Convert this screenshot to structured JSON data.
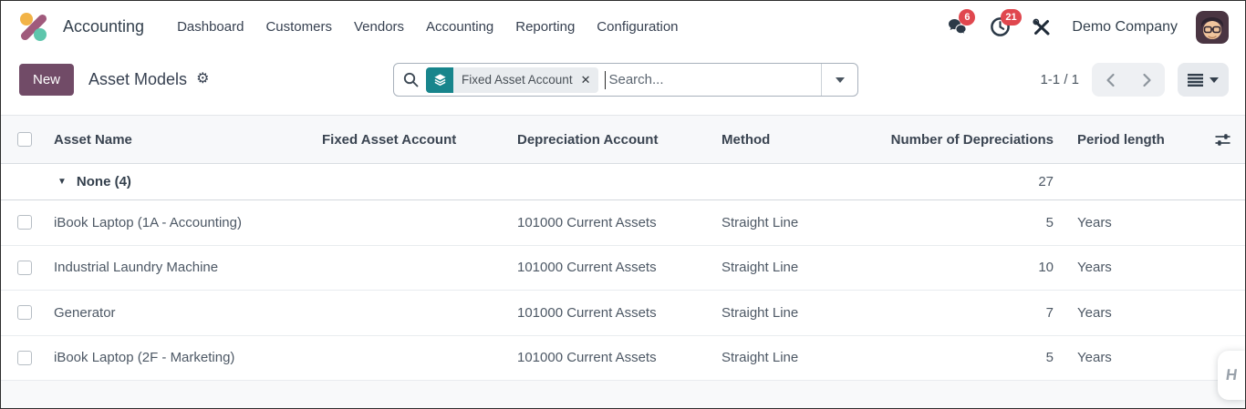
{
  "navbar": {
    "app_name": "Accounting",
    "menu_items": [
      {
        "label": "Dashboard"
      },
      {
        "label": "Customers"
      },
      {
        "label": "Vendors"
      },
      {
        "label": "Accounting"
      },
      {
        "label": "Reporting"
      },
      {
        "label": "Configuration"
      }
    ],
    "messages_badge": "6",
    "activities_badge": "21",
    "company_name": "Demo Company"
  },
  "control_panel": {
    "new_button_label": "New",
    "title": "Asset Models",
    "search": {
      "facet_label": "Fixed Asset Account",
      "placeholder": "Search..."
    },
    "pager_text": "1-1 / 1"
  },
  "table": {
    "headers": {
      "asset_name": "Asset Name",
      "fixed_asset_account": "Fixed Asset Account",
      "depreciation_account": "Depreciation Account",
      "method": "Method",
      "number_of_depreciations": "Number of Depreciations",
      "period_length": "Period length"
    },
    "group_row": {
      "label": "None (4)",
      "number_of_depreciations_sum": "27"
    },
    "rows": [
      {
        "asset_name": "iBook Laptop (1A - Accounting)",
        "fixed_asset_account": "",
        "depreciation_account": "101000 Current Assets",
        "method": "Straight Line",
        "number_of_depreciations": "5",
        "period_length": "Years"
      },
      {
        "asset_name": "Industrial Laundry Machine",
        "fixed_asset_account": "",
        "depreciation_account": "101000 Current Assets",
        "method": "Straight Line",
        "number_of_depreciations": "10",
        "period_length": "Years"
      },
      {
        "asset_name": "Generator",
        "fixed_asset_account": "",
        "depreciation_account": "101000 Current Assets",
        "method": "Straight Line",
        "number_of_depreciations": "7",
        "period_length": "Years"
      },
      {
        "asset_name": "iBook Laptop (2F - Marketing)",
        "fixed_asset_account": "",
        "depreciation_account": "101000 Current Assets",
        "method": "Straight Line",
        "number_of_depreciations": "5",
        "period_length": "Years"
      }
    ]
  },
  "icons": {
    "gear": "⚙",
    "close": "✕",
    "group_triangle": "▼",
    "floating_widget_glyph": "H"
  },
  "colors": {
    "accent_purple": "#714B67",
    "facet_teal": "#18858c",
    "badge_red": "#e0474e"
  }
}
